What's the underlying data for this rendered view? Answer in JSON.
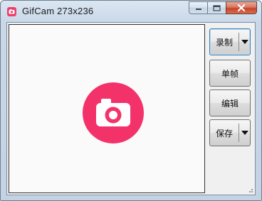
{
  "window": {
    "title": "GifCam 273x236",
    "accent_color": "#f13c6a"
  },
  "caption": {
    "minimize": "minimize-icon",
    "maximize": "maximize-icon",
    "close": "close-icon"
  },
  "capture_area": {
    "logo_icon": "camera-icon",
    "logo_color": "#f4326a"
  },
  "buttons": {
    "record_label": "录制",
    "frame_label": "单帧",
    "edit_label": "编辑",
    "save_label": "保存"
  }
}
